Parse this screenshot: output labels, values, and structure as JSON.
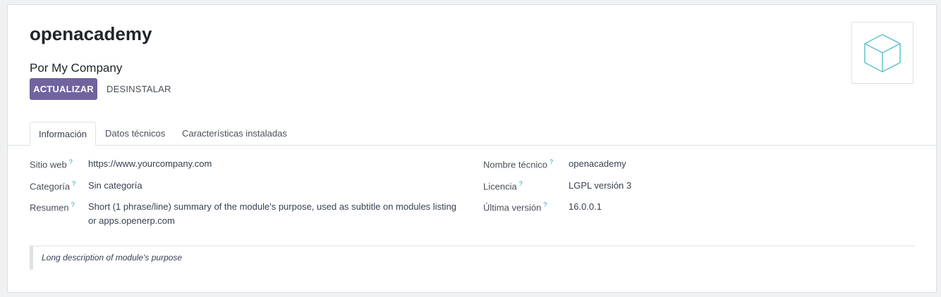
{
  "module": {
    "title": "openacademy",
    "author": "Por My Company",
    "icon": "cube-icon"
  },
  "actions": {
    "upgrade_label": "ACTUALIZAR",
    "uninstall_label": "DESINSTALAR"
  },
  "tabs": [
    {
      "label": "Información",
      "active": true
    },
    {
      "label": "Datos técnicos",
      "active": false
    },
    {
      "label": "Características instaladas",
      "active": false
    }
  ],
  "fields": {
    "website": {
      "label": "Sitio web",
      "help": "?",
      "value": "https://www.yourcompany.com"
    },
    "category": {
      "label": "Categoría",
      "help": "?",
      "value": "Sin categoría"
    },
    "summary": {
      "label": "Resumen",
      "help": "?",
      "value_line1": "Short (1 phrase/line) summary of the module's purpose, used as subtitle on modules listing",
      "value_line2": "or apps.openerp.com"
    },
    "technical_name": {
      "label": "Nombre técnico",
      "help": "?",
      "value": "openacademy"
    },
    "license": {
      "label": "Licencia",
      "help": "?",
      "value": "LGPL versión 3"
    },
    "latest_version": {
      "label": "Última versión",
      "help": "?",
      "value": "16.0.0.1"
    }
  },
  "description": "Long description of module's purpose",
  "colors": {
    "primary": "#71639e",
    "help_mark": "#17a2b8",
    "icon_stroke": "#5fc3c9"
  }
}
